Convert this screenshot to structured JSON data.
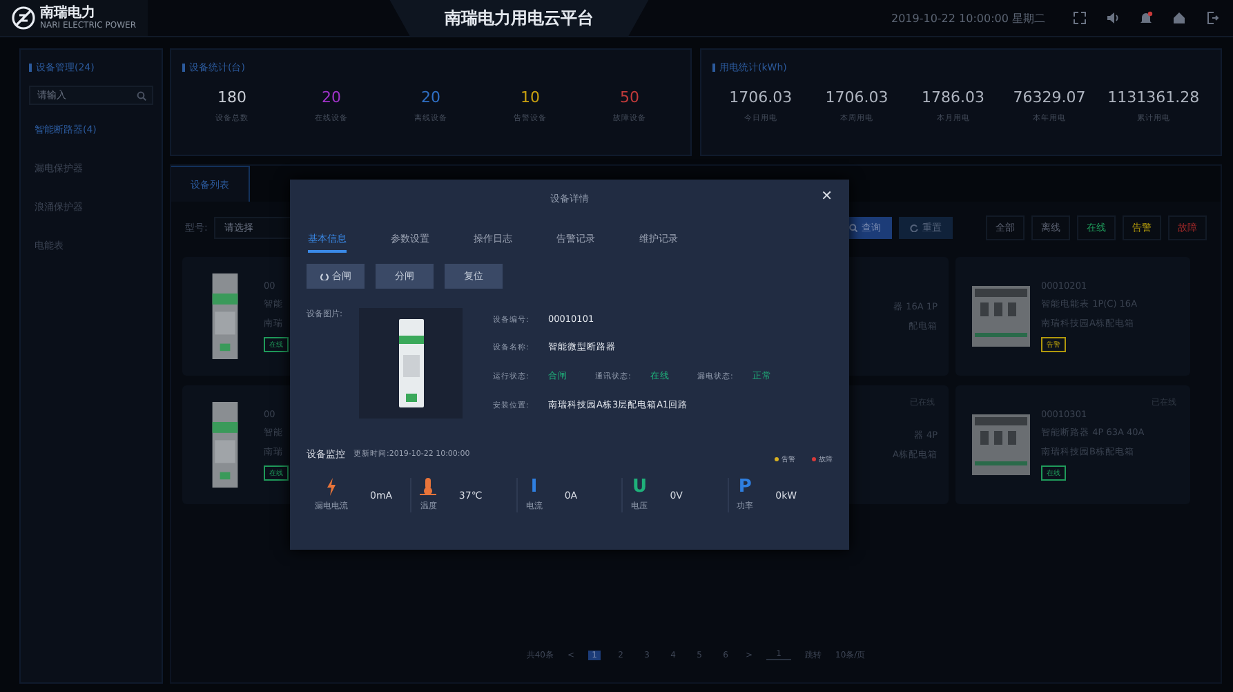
{
  "header": {
    "logo": "南瑞电力",
    "logo_sub": "NARI ELECTRIC POWER",
    "title": "南瑞电力用电云平台",
    "datetime": "2019-10-22 10:00:00 星期二"
  },
  "sidebar": {
    "title": "设备管理(24)",
    "search": {
      "placeholder": "请输入"
    },
    "items": [
      {
        "label": "智能断路器(4)",
        "selected": true
      },
      {
        "label": "漏电保护器",
        "selected": false
      },
      {
        "label": "浪涌保护器",
        "selected": false
      },
      {
        "label": "电能表",
        "selected": false
      }
    ]
  },
  "device_stats": {
    "title": "设备统计(台)",
    "items": [
      {
        "value": "180",
        "label": "设备总数",
        "color": "#c8ccd4"
      },
      {
        "value": "20",
        "label": "在线设备",
        "color": "#a033c8"
      },
      {
        "value": "20",
        "label": "离线设备",
        "color": "#2f6fc4"
      },
      {
        "value": "10",
        "label": "告警设备",
        "color": "#c8a010"
      },
      {
        "value": "50",
        "label": "故障设备",
        "color": "#c03a3a"
      }
    ]
  },
  "power_stats": {
    "title": "用电统计(kWh)",
    "items": [
      {
        "value": "1706.03",
        "label": "今日用电"
      },
      {
        "value": "1706.03",
        "label": "本周用电"
      },
      {
        "value": "1786.03",
        "label": "本月用电"
      },
      {
        "value": "76329.07",
        "label": "本年用电"
      },
      {
        "value": "1131361.28",
        "label": "累计用电"
      }
    ]
  },
  "main": {
    "tabs": [
      {
        "label": "设备列表",
        "selected": true
      }
    ],
    "filter": {
      "label": "型号:",
      "placeholder": "请选择"
    },
    "buttons": [
      {
        "label": "查询",
        "kind": "primary"
      },
      {
        "label": "重置",
        "kind": "plain"
      }
    ],
    "status_filters": [
      {
        "label": "全部",
        "color": "#5a6070"
      },
      {
        "label": "离线",
        "color": "#5a6070"
      },
      {
        "label": "在线",
        "color": "#1f9a5a"
      },
      {
        "label": "告警",
        "color": "#b0980c"
      },
      {
        "label": "故障",
        "color": "#a02828"
      }
    ],
    "cards": [
      {
        "kind": "left",
        "lines": [
          "00",
          "智能",
          "南瑞"
        ],
        "tag": {
          "label": "在线",
          "color": "#1f9a5a"
        }
      },
      {
        "kind": "right",
        "lines": [
          "器 16A 1P",
          "配电箱"
        ]
      },
      {
        "kind": "full",
        "lines": [
          "00010201",
          "智能电能表 1P(C) 16A",
          "南瑞科技园A栋配电箱"
        ],
        "tag": {
          "label": "告警",
          "color": "#b0980c"
        }
      },
      {
        "kind": "left",
        "lines": [
          "00",
          "智能",
          "南瑞"
        ],
        "tag": {
          "label": "在线",
          "color": "#1f9a5a"
        }
      },
      {
        "kind": "right",
        "corner": "已在线",
        "lines": [
          "器 4P",
          "A栋配电箱"
        ]
      },
      {
        "kind": "full",
        "corner": "已在线",
        "lines": [
          "00010301",
          "智能断路器 4P 63A 40A",
          "南瑞科技园B栋配电箱"
        ],
        "tag": {
          "label": "在线",
          "color": "#1f9a5a"
        }
      }
    ],
    "pagination": {
      "total": "共40条",
      "prev": "<",
      "next": ">",
      "pages": [
        {
          "label": "1",
          "selected": true
        },
        {
          "label": "2",
          "selected": false
        },
        {
          "label": "3",
          "selected": false
        },
        {
          "label": "4",
          "selected": false
        },
        {
          "label": "5",
          "selected": false
        },
        {
          "label": "6",
          "selected": false
        }
      ],
      "jump_value": "1",
      "jump_label": "跳转",
      "page_size": "10条/页"
    }
  },
  "modal": {
    "title": "设备详情",
    "close": "✕",
    "tabs": [
      {
        "label": "基本信息",
        "selected": true
      },
      {
        "label": "参数设置",
        "selected": false
      },
      {
        "label": "操作日志",
        "selected": false
      },
      {
        "label": "告警记录",
        "selected": false
      },
      {
        "label": "维护记录",
        "selected": false
      }
    ],
    "actions": [
      "合闸",
      "分闸",
      "复位"
    ],
    "image_label": "设备图片:",
    "rows": [
      [
        {
          "label": "设备编号:",
          "value": "00010101",
          "highlight": false
        }
      ],
      [
        {
          "label": "设备名称:",
          "value": "智能微型断路器",
          "highlight": false
        }
      ],
      [
        {
          "label": "运行状态:",
          "value": "合闸",
          "highlight": true
        },
        {
          "label": "通讯状态:",
          "value": "在线",
          "highlight": true
        },
        {
          "label": "漏电状态:",
          "value": "正常",
          "highlight": true
        }
      ],
      [
        {
          "label": "安装位置:",
          "value": "南瑞科技园A栋3层配电箱A1回路",
          "highlight": false
        }
      ]
    ],
    "monitor_title": "设备监控",
    "monitor_time": "更新时间:2019-10-22 10:00:00",
    "legend": [
      {
        "label": "告警",
        "color": "#d8b020"
      },
      {
        "label": "故障",
        "color": "#d83a3a"
      }
    ],
    "metrics": [
      {
        "kind": "bolt",
        "label": "漏电电流",
        "value": "0mA",
        "color": "#e8743a"
      },
      {
        "kind": "thermo",
        "label": "温度",
        "value": "37℃",
        "color": "#e8743a"
      },
      {
        "kind": "letter",
        "symbol": "I",
        "label": "电流",
        "value": "0A",
        "color": "#2f7fe0"
      },
      {
        "kind": "letter",
        "symbol": "U",
        "label": "电压",
        "value": "0V",
        "color": "#1fb07a"
      },
      {
        "kind": "letter",
        "symbol": "P",
        "label": "功率",
        "value": "0kW",
        "color": "#2f7fe0"
      }
    ]
  }
}
